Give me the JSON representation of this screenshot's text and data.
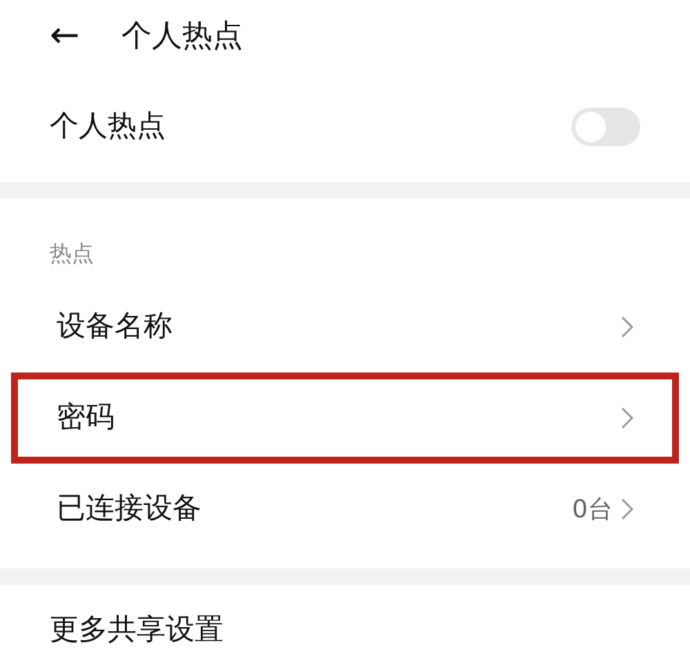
{
  "header": {
    "back": "←",
    "title": "个人热点"
  },
  "toggle_row": {
    "label": "个人热点",
    "on": false
  },
  "section": {
    "label": "热点"
  },
  "rows": [
    {
      "label": "设备名称",
      "value": null,
      "highlighted": false
    },
    {
      "label": "密码",
      "value": null,
      "highlighted": true
    },
    {
      "label": "已连接设备",
      "value": "0台",
      "highlighted": false
    }
  ],
  "more": {
    "label": "更多共享设置"
  }
}
